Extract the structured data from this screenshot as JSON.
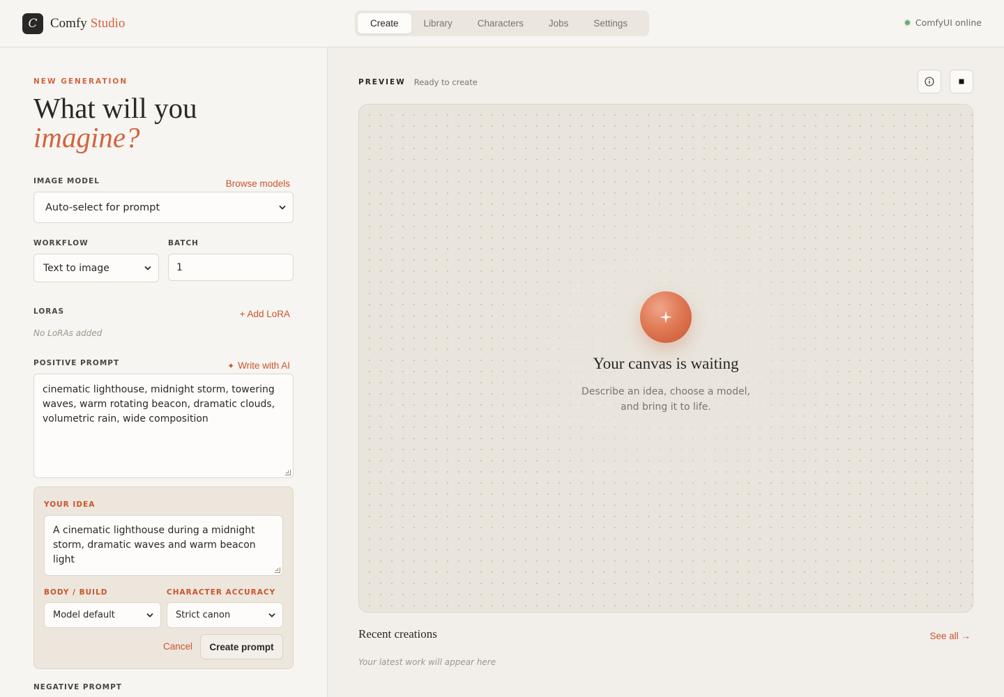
{
  "header": {
    "logo_letter": "C",
    "brand_name": "Comfy",
    "brand_accent": "Studio",
    "tabs": [
      {
        "label": "Create",
        "active": true
      },
      {
        "label": "Library",
        "active": false
      },
      {
        "label": "Characters",
        "active": false
      },
      {
        "label": "Jobs",
        "active": false
      },
      {
        "label": "Settings",
        "active": false
      }
    ],
    "status": "ComfyUI online"
  },
  "form": {
    "eyebrow": "NEW GENERATION",
    "headline": "What will you",
    "headline_accent": "imagine?",
    "image_model": {
      "label": "IMAGE MODEL",
      "link": "Browse models",
      "value": "Auto-select for prompt"
    },
    "workflow": {
      "label": "WORKFLOW",
      "value": "Text to image"
    },
    "batch": {
      "label": "BATCH",
      "value": "1"
    },
    "loras": {
      "label": "LORAS",
      "add_link": "+ Add LoRA",
      "empty": "No LoRAs added"
    },
    "positive_prompt": {
      "label": "POSITIVE PROMPT",
      "ai_link": "Write with AI",
      "value": "cinematic lighthouse, midnight storm, towering waves, warm rotating beacon, dramatic clouds, volumetric rain, wide composition"
    },
    "idea": {
      "label": "YOUR IDEA",
      "value": "A cinematic lighthouse during a midnight storm, dramatic waves and warm beacon light",
      "body_label": "BODY / BUILD",
      "body_value": "Model default",
      "accuracy_label": "CHARACTER ACCURACY",
      "accuracy_value": "Strict canon",
      "cancel": "Cancel",
      "create": "Create prompt"
    },
    "negative_prompt_label": "NEGATIVE PROMPT"
  },
  "preview": {
    "label": "PREVIEW",
    "status": "Ready to create",
    "info_icon": "info-icon",
    "stop_icon": "stop-icon",
    "canvas_title": "Your canvas is waiting",
    "canvas_desc_1": "Describe an idea, choose a model,",
    "canvas_desc_2": "and bring it to life.",
    "recent_title": "Recent creations",
    "see_all": "See all →",
    "recent_empty": "Your latest work will appear here"
  },
  "colors": {
    "accent": "#d2633f",
    "status_online": "#6fa57d",
    "background": "#f6f4ef",
    "idea_card": "#ece6dc"
  }
}
